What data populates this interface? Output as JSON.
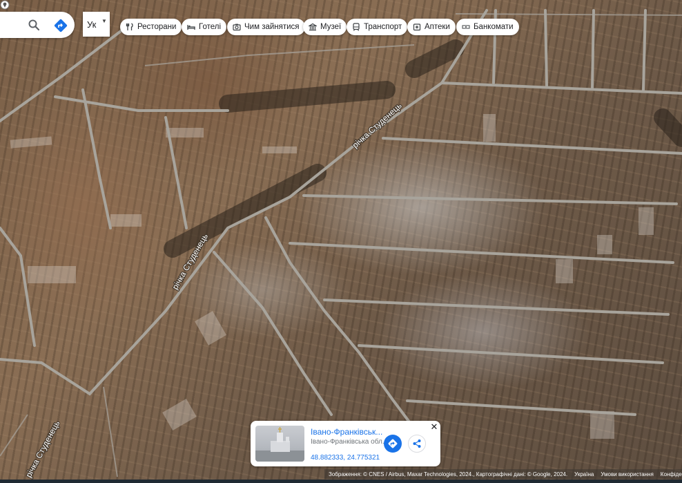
{
  "search": {
    "icon": "search-icon",
    "directions_icon": "directions-icon"
  },
  "language": {
    "value": "Ук"
  },
  "chips": [
    {
      "label": "Ресторани",
      "icon": "restaurant-icon"
    },
    {
      "label": "Готелі",
      "icon": "hotel-icon"
    },
    {
      "label": "Чим зайнятися",
      "icon": "camera-icon"
    },
    {
      "label": "Музеї",
      "icon": "museum-icon"
    },
    {
      "label": "Транспорт",
      "icon": "transit-icon"
    },
    {
      "label": "Аптеки",
      "icon": "pharmacy-icon"
    },
    {
      "label": "Банкомати",
      "icon": "atm-icon"
    }
  ],
  "map": {
    "road_labels": [
      "річка Студенець",
      "річка Студенець",
      "річка Студенець"
    ]
  },
  "place_card": {
    "title": "Івано-Франківськ...",
    "subtitle": "Івано-Франківська обл...",
    "coordinates": "48.882333, 24.775321",
    "close_label": "✕"
  },
  "attribution": {
    "imagery": "Зображення: © CNES / Airbus, Maxar Technologies, 2024., Картографічні дані: © Google, 2024.",
    "country": "Україна",
    "terms": "Умови використання",
    "privacy": "Конфіденційність"
  },
  "colors": {
    "accent": "#1a73e8",
    "road": "#a8a49c"
  }
}
